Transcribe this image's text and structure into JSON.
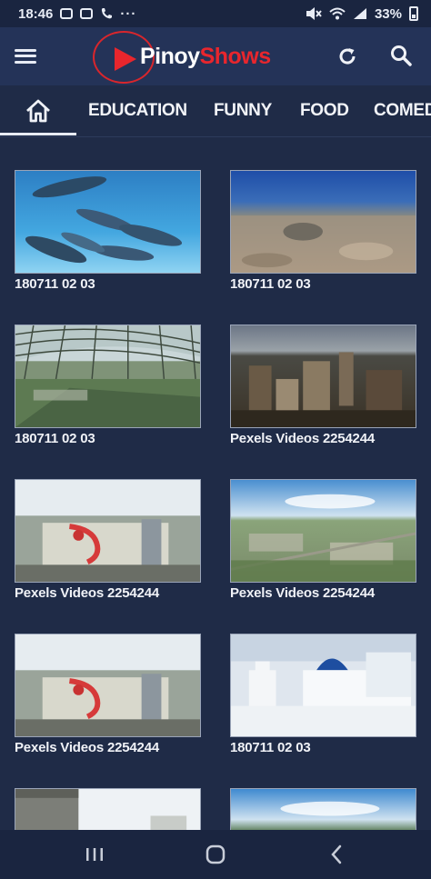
{
  "status_bar": {
    "time": "18:46",
    "left_icons": [
      "gallery-icon",
      "message-icon",
      "phone-icon"
    ],
    "more": "···",
    "battery": "33%"
  },
  "app_bar": {
    "logo_part1": "Pinoy",
    "logo_part2": "Shows",
    "brand_red": "#e8262d"
  },
  "tabs": [
    {
      "label": "EDUCATION"
    },
    {
      "label": "FUNNY"
    },
    {
      "label": "FOOD"
    },
    {
      "label": "COMEDY"
    }
  ],
  "videos": [
    {
      "title": "180711 02 03",
      "thumb": "dolphins"
    },
    {
      "title": "180711 02 03",
      "thumb": "seabed"
    },
    {
      "title": "180711 02 03",
      "thumb": "glass-canopy"
    },
    {
      "title": "Pexels Videos 2254244",
      "thumb": "city-aerial"
    },
    {
      "title": "Pexels Videos 2254244",
      "thumb": "mural"
    },
    {
      "title": "Pexels Videos 2254244",
      "thumb": "city-sky"
    },
    {
      "title": "Pexels Videos 2254244",
      "thumb": "mural"
    },
    {
      "title": "180711 02 03",
      "thumb": "santorini"
    },
    {
      "title": "",
      "thumb": "street"
    },
    {
      "title": "",
      "thumb": "city-sky"
    }
  ]
}
